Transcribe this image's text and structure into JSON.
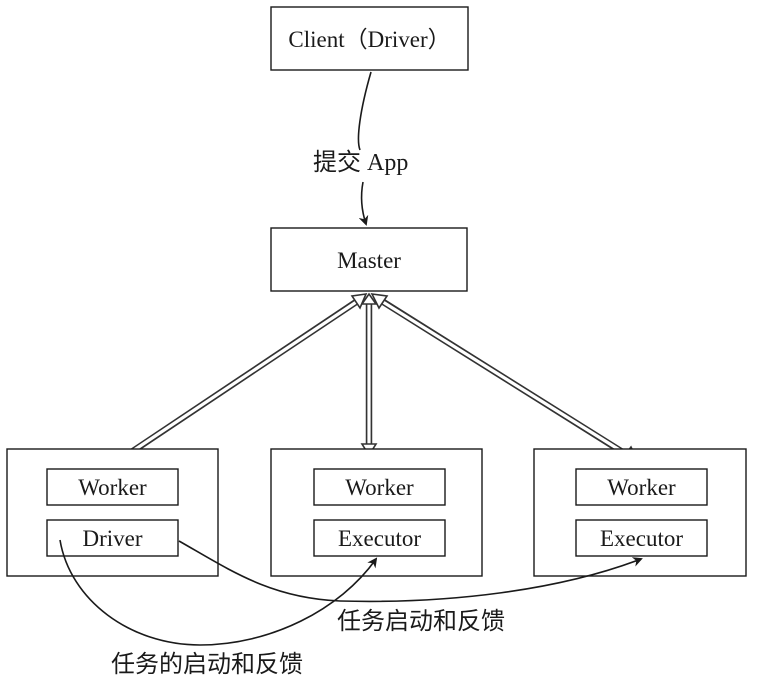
{
  "nodes": {
    "client": "Client（Driver）",
    "master": "Master",
    "left_worker": "Worker",
    "left_driver": "Driver",
    "mid_worker": "Worker",
    "mid_executor": "Executor",
    "right_worker": "Worker",
    "right_executor": "Executor"
  },
  "edges": {
    "submit_app": "提交 App",
    "task_launch_feedback": "任务启动和反馈",
    "task_launch_feedback_2": "任务的启动和反馈"
  },
  "colors": {
    "stroke": "#1a1a1a",
    "background": "#ffffff"
  }
}
